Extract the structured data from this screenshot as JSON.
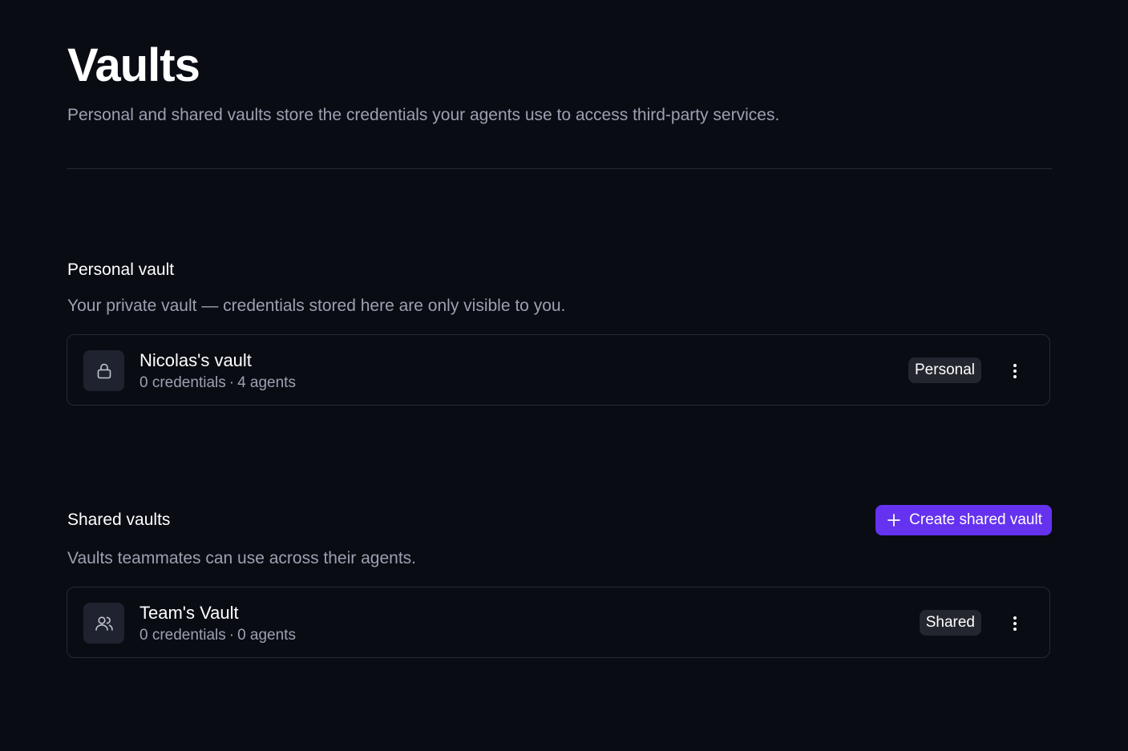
{
  "header": {
    "title": "Vaults",
    "subtitle": "Personal and shared vaults store the credentials your agents use to access third-party services."
  },
  "personal_section": {
    "title": "Personal vault",
    "description": "Your private vault — credentials stored here are only visible to you.",
    "vault": {
      "name": "Nicolas's vault",
      "credentials": "0 credentials",
      "separator": "·",
      "agents": "4 agents",
      "badge": "Personal",
      "icon": "lock-icon"
    }
  },
  "shared_section": {
    "title": "Shared vaults",
    "description": "Vaults teammates can use across their agents.",
    "create_button_label": "Create shared vault",
    "vaults": [
      {
        "name": "Team's Vault",
        "credentials": "0 credentials",
        "separator": "·",
        "agents": "0 agents",
        "badge": "Shared",
        "icon": "users-icon"
      }
    ]
  },
  "colors": {
    "background": "#0a0c14",
    "accent": "#6532f0",
    "muted_text": "#9ca1b0",
    "border": "#262a36",
    "badge_bg": "#23262f"
  }
}
